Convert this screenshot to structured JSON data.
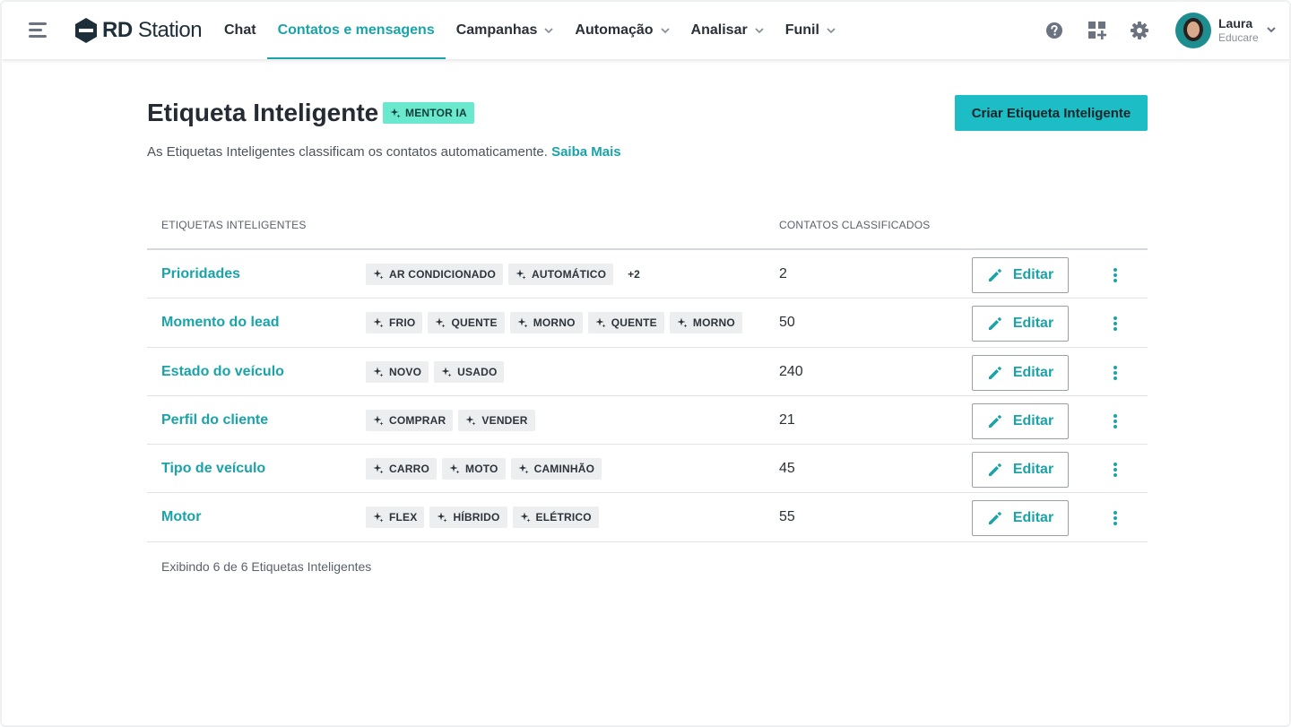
{
  "app": {
    "brand": {
      "bold": "RD",
      "light": "Station"
    },
    "nav": [
      {
        "label": "Chat",
        "active": false,
        "dropdown": false
      },
      {
        "label": "Contatos e mensagens",
        "active": true,
        "dropdown": false
      },
      {
        "label": "Campanhas",
        "active": false,
        "dropdown": true
      },
      {
        "label": "Automação",
        "active": false,
        "dropdown": true
      },
      {
        "label": "Analisar",
        "active": false,
        "dropdown": true
      },
      {
        "label": "Funil",
        "active": false,
        "dropdown": true
      }
    ],
    "user": {
      "name": "Laura",
      "org": "Educare"
    },
    "icons": [
      "hamburger-icon",
      "help-icon",
      "apps-add-icon",
      "gear-icon",
      "chevron-down-icon"
    ]
  },
  "page": {
    "title": "Etiqueta Inteligente",
    "badge": "MENTOR IA",
    "create_button": "Criar Etiqueta Inteligente",
    "subtitle": "As Etiquetas Inteligentes classificam os contatos automaticamente.",
    "subtitle_link": "Saiba Mais"
  },
  "table": {
    "headers": {
      "name": "ETIQUETAS INTELIGENTES",
      "count": "CONTATOS CLASSIFICADOS"
    },
    "edit_label": "Editar",
    "rows": [
      {
        "name": "Prioridades",
        "tags": [
          "AR CONDICIONADO",
          "AUTOMÁTICO"
        ],
        "more": "+2",
        "count": "2"
      },
      {
        "name": "Momento do lead",
        "tags": [
          "FRIO",
          "QUENTE",
          "MORNO",
          "QUENTE",
          "MORNO"
        ],
        "more": "",
        "count": "50"
      },
      {
        "name": "Estado do veículo",
        "tags": [
          "NOVO",
          "USADO"
        ],
        "more": "",
        "count": "240"
      },
      {
        "name": "Perfil do cliente",
        "tags": [
          "COMPRAR",
          "VENDER"
        ],
        "more": "",
        "count": "21"
      },
      {
        "name": "Tipo de veículo",
        "tags": [
          "CARRO",
          "MOTO",
          "CAMINHÃO"
        ],
        "more": "",
        "count": "45"
      },
      {
        "name": "Motor",
        "tags": [
          "FLEX",
          "HÍBRIDO",
          "ELÉTRICO"
        ],
        "more": "",
        "count": "55"
      }
    ],
    "footer": "Exibindo 6 de 6 Etiquetas Inteligentes"
  },
  "colors": {
    "accent": "#1aa3a8",
    "button": "#1cbdc5",
    "badge": "#6ae9cf"
  }
}
